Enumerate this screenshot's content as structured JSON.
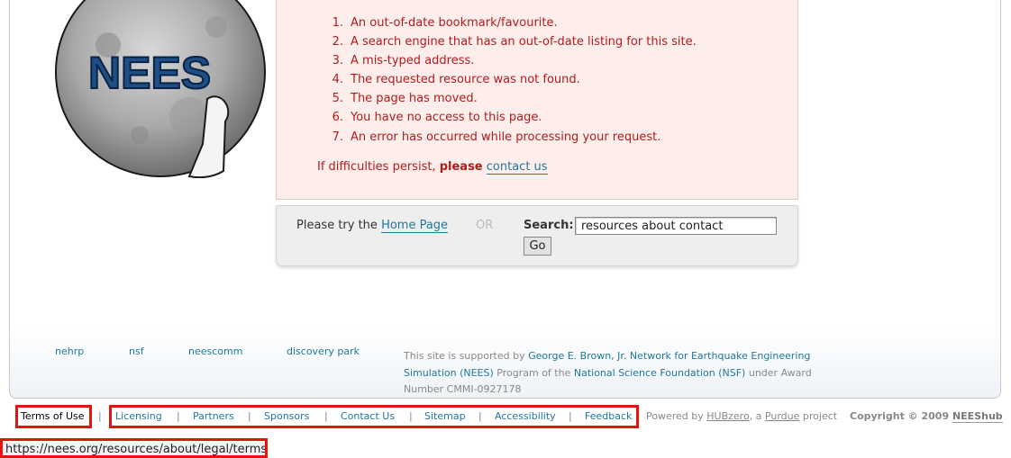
{
  "logo": {
    "text": "NEES"
  },
  "error": {
    "reasons": [
      {
        "num": "1.",
        "text": "An out-of-date bookmark/favourite."
      },
      {
        "num": "2.",
        "text": "A search engine that has an out-of-date listing for this site."
      },
      {
        "num": "3.",
        "text": "A mis-typed address."
      },
      {
        "num": "4.",
        "text": "The requested resource was not found."
      },
      {
        "num": "5.",
        "text": "The page has moved."
      },
      {
        "num": "6.",
        "text": "You have no access to this page."
      },
      {
        "num": "7.",
        "text": "An error has occurred while processing your request."
      }
    ],
    "persist_prefix": "If difficulties persist,",
    "persist_please": "please",
    "contact_link": "contact us"
  },
  "search": {
    "try_prefix": "Please try the",
    "home_link": "Home Page",
    "or": "OR",
    "label": "Search:",
    "value": "resources about contact",
    "go": "Go"
  },
  "sponsors": {
    "items": [
      "nehrp",
      "nsf",
      "neescomm",
      "discovery park"
    ],
    "support_prefix": "This site is supported by",
    "support_link1": "George E. Brown, Jr. Network for Earthquake Engineering Simulation (NEES)",
    "support_mid": "Program of the",
    "support_link2": "National Science Foundation (NSF)",
    "support_suffix": "under Award Number CMMI-0927178"
  },
  "footer": {
    "terms": "Terms of Use",
    "links": [
      "Licensing",
      "Partners",
      "Sponsors",
      "Contact Us",
      "Sitemap",
      "Accessibility",
      "Feedback"
    ],
    "sep": "|",
    "powered_prefix": "Powered by",
    "hubzero": "HUBzero",
    "powered_mid": ", a",
    "purdue": "Purdue",
    "powered_suffix": "project",
    "copyright": "Copyright © 2009",
    "neeshub": "NEEShub"
  },
  "status_url": "https://nees.org/resources/about/legal/terms",
  "colors": {
    "error_text": "#b31b1b",
    "link": "#21779e",
    "highlight": "#e8120c",
    "error_bg": "#fdeeec"
  }
}
